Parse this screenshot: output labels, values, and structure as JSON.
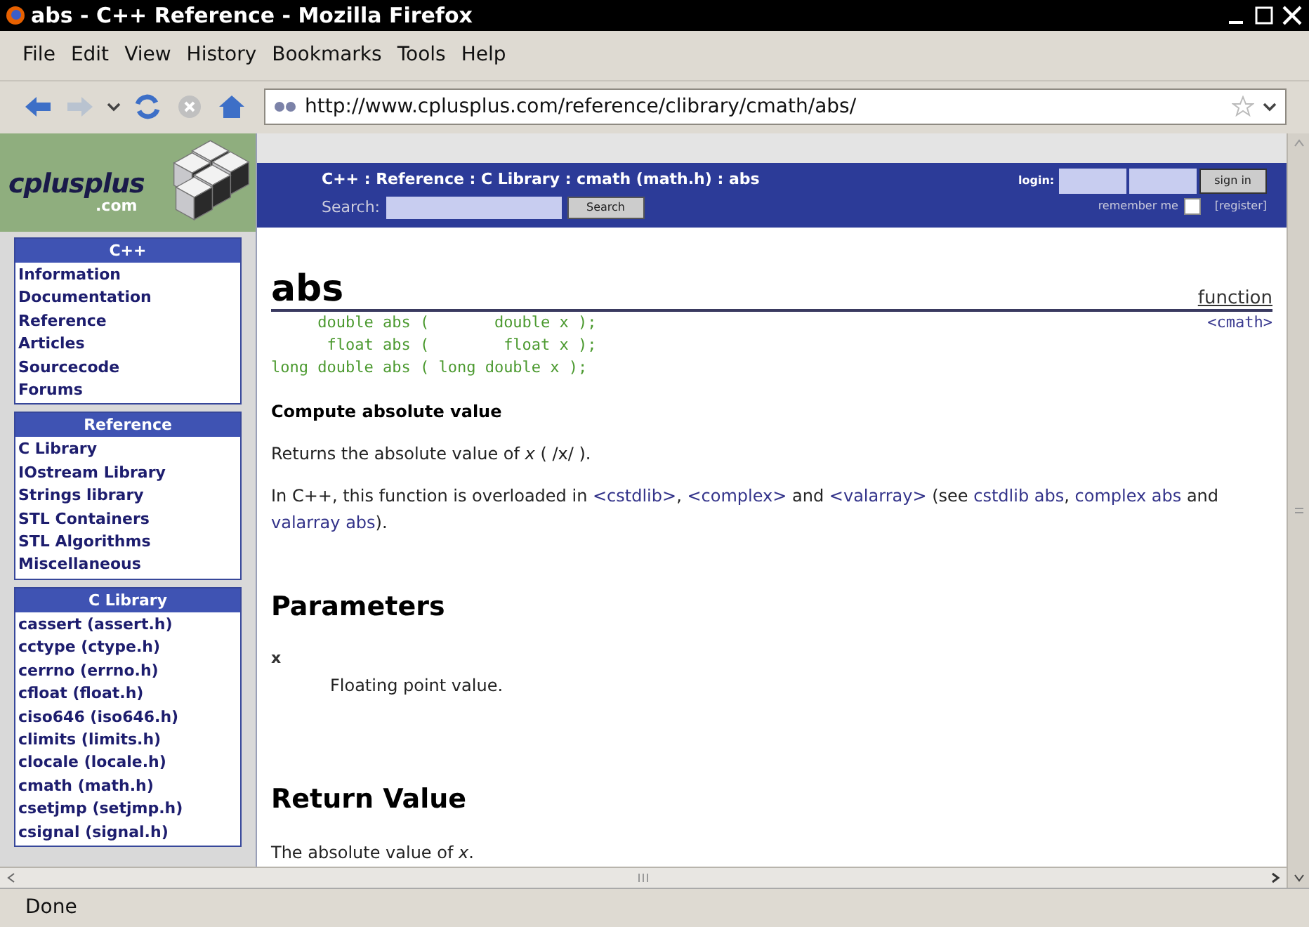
{
  "window": {
    "title": "abs - C++ Reference - Mozilla Firefox"
  },
  "menu": [
    "File",
    "Edit",
    "View",
    "History",
    "Bookmarks",
    "Tools",
    "Help"
  ],
  "address_bar": {
    "url": "http://www.cplusplus.com/reference/clibrary/cmath/abs/"
  },
  "logo": {
    "name": "cplusplus",
    "suffix": ".com"
  },
  "banner": {
    "breadcrumb": "C++ : Reference : C Library : cmath (math.h) : abs",
    "search_label": "Search:",
    "search_button": "Search",
    "login_label": "login:",
    "sign_in_button": "sign in",
    "remember_label": "remember me",
    "remember_checked": false,
    "register_link": "[register]"
  },
  "sidebar": [
    {
      "title": "C++",
      "items": [
        "Information",
        "Documentation",
        "Reference",
        "Articles",
        "Sourcecode",
        "Forums"
      ]
    },
    {
      "title": "Reference",
      "items": [
        "C Library",
        "IOstream Library",
        "Strings library",
        "STL Containers",
        "STL Algorithms",
        "Miscellaneous"
      ]
    },
    {
      "title": "C Library",
      "items": [
        "cassert (assert.h)",
        "cctype (ctype.h)",
        "cerrno (errno.h)",
        "cfloat (float.h)",
        "ciso646 (iso646.h)",
        "climits (limits.h)",
        "clocale (locale.h)",
        "cmath (math.h)",
        "csetjmp (setjmp.h)",
        "csignal (signal.h)"
      ]
    }
  ],
  "article": {
    "title": "abs",
    "kind_label": "function",
    "header_link": "<cmath>",
    "prototypes": [
      "     double abs (       double x );",
      "      float abs (        float x );",
      "long double abs ( long double x );"
    ],
    "summary": "Compute absolute value",
    "description": "Returns the absolute value of *x* ( /x/ ).",
    "overload_paragraph": [
      {
        "kind": "text",
        "text": "In C++, this function is overloaded in "
      },
      {
        "kind": "link",
        "text": "<cstdlib>"
      },
      {
        "kind": "text",
        "text": ", "
      },
      {
        "kind": "link",
        "text": "<complex>"
      },
      {
        "kind": "text",
        "text": " and "
      },
      {
        "kind": "link",
        "text": "<valarray>"
      },
      {
        "kind": "text",
        "text": " (see "
      },
      {
        "kind": "link",
        "text": "cstdlib abs"
      },
      {
        "kind": "text",
        "text": ", "
      },
      {
        "kind": "link",
        "text": "complex abs"
      },
      {
        "kind": "text",
        "text": " and "
      },
      {
        "kind": "link",
        "text": "valarray abs"
      },
      {
        "kind": "text",
        "text": ")."
      }
    ],
    "parameters_heading": "Parameters",
    "parameter_name": "x",
    "parameter_description": "Floating point value.",
    "return_heading": "Return Value",
    "return_text": "The absolute value of *x*."
  },
  "status_bar": {
    "text": "Done"
  }
}
